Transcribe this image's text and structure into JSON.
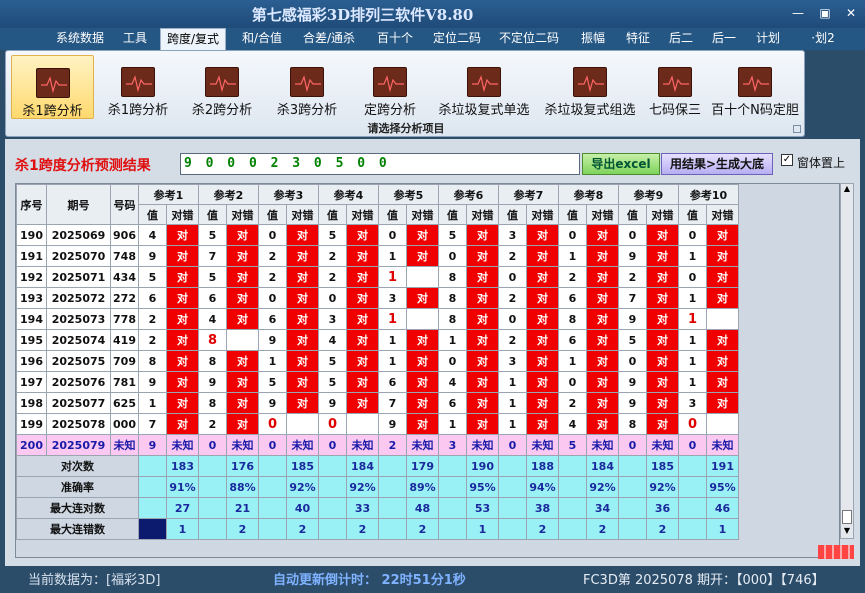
{
  "window": {
    "title": "第七感福彩3D排列三软件V8.80",
    "controls": [
      "—",
      "▣",
      "✕"
    ]
  },
  "menu": [
    "系统数据",
    "工具",
    "跨度/复式",
    "和/合值",
    "合差/通杀",
    "百十个",
    "定位二码",
    "不定位二码",
    "振幅",
    "特征",
    "后二",
    "后一",
    "计划",
    "·划2"
  ],
  "ribbon": {
    "buttons": [
      "杀1跨分析",
      "杀1跨分析",
      "杀2跨分析",
      "杀3跨分析",
      "定跨分析",
      "杀垃圾复式单选",
      "杀垃圾复式组选",
      "七码保三",
      "百十个N码定胆"
    ],
    "caption": "请选择分析项目"
  },
  "panel": {
    "title": "杀1跨度分析预测结果",
    "result": "9 0 0 0 2 3 0 5 0 0",
    "excel_button": "导出excel",
    "gen_button": "用结果>生成大底",
    "ontop_check": "✓",
    "ontop_label": "窗体置上"
  },
  "table": {
    "headers": {
      "seq": "序号",
      "period": "期号",
      "code": "号码",
      "refs": [
        "参考1",
        "参考2",
        "参考3",
        "参考4",
        "参考5",
        "参考6",
        "参考7",
        "参考8",
        "参考9",
        "参考10"
      ],
      "val": "值",
      "dc": "对错"
    },
    "rows": [
      {
        "seq": "190",
        "period": "2025069",
        "code": "906",
        "v": [
          "4",
          "5",
          "0",
          "5",
          "0",
          "5",
          "3",
          "0",
          "0",
          "0"
        ],
        "r": [
          "对",
          "对",
          "对",
          "对",
          "对",
          "对",
          "对",
          "对",
          "对",
          "对"
        ]
      },
      {
        "seq": "191",
        "period": "2025070",
        "code": "748",
        "v": [
          "9",
          "7",
          "2",
          "2",
          "1",
          "0",
          "2",
          "1",
          "9",
          "1"
        ],
        "r": [
          "对",
          "对",
          "对",
          "对",
          "对",
          "对",
          "对",
          "对",
          "对",
          "对"
        ]
      },
      {
        "seq": "192",
        "period": "2025071",
        "code": "434",
        "v": [
          "5",
          "5",
          "2",
          "2",
          "1",
          "8",
          "0",
          "2",
          "2",
          "0"
        ],
        "r": [
          "对",
          "对",
          "对",
          "对",
          "",
          "对",
          "对",
          "对",
          "对",
          "对"
        ]
      },
      {
        "seq": "193",
        "period": "2025072",
        "code": "272",
        "v": [
          "6",
          "6",
          "0",
          "0",
          "3",
          "8",
          "2",
          "6",
          "7",
          "1"
        ],
        "r": [
          "对",
          "对",
          "对",
          "对",
          "对",
          "对",
          "对",
          "对",
          "对",
          "对"
        ]
      },
      {
        "seq": "194",
        "period": "2025073",
        "code": "778",
        "v": [
          "2",
          "4",
          "6",
          "3",
          "1",
          "8",
          "0",
          "8",
          "9",
          "1"
        ],
        "r": [
          "对",
          "对",
          "对",
          "对",
          "",
          "对",
          "对",
          "对",
          "对",
          ""
        ]
      },
      {
        "seq": "195",
        "period": "2025074",
        "code": "419",
        "v": [
          "2",
          "8",
          "9",
          "4",
          "1",
          "1",
          "2",
          "6",
          "5",
          "1"
        ],
        "r": [
          "对",
          "",
          "对",
          "对",
          "对",
          "对",
          "对",
          "对",
          "对",
          "对"
        ]
      },
      {
        "seq": "196",
        "period": "2025075",
        "code": "709",
        "v": [
          "8",
          "8",
          "1",
          "5",
          "1",
          "0",
          "3",
          "1",
          "0",
          "1"
        ],
        "r": [
          "对",
          "对",
          "对",
          "对",
          "对",
          "对",
          "对",
          "对",
          "对",
          "对"
        ]
      },
      {
        "seq": "197",
        "period": "2025076",
        "code": "781",
        "v": [
          "9",
          "9",
          "5",
          "5",
          "6",
          "4",
          "1",
          "0",
          "9",
          "1"
        ],
        "r": [
          "对",
          "对",
          "对",
          "对",
          "对",
          "对",
          "对",
          "对",
          "对",
          "对"
        ]
      },
      {
        "seq": "198",
        "period": "2025077",
        "code": "625",
        "v": [
          "1",
          "8",
          "9",
          "9",
          "7",
          "6",
          "1",
          "2",
          "9",
          "3"
        ],
        "r": [
          "对",
          "对",
          "对",
          "对",
          "对",
          "对",
          "对",
          "对",
          "对",
          "对"
        ]
      },
      {
        "seq": "199",
        "period": "2025078",
        "code": "000",
        "v": [
          "7",
          "2",
          "0",
          "0",
          "9",
          "1",
          "1",
          "4",
          "8",
          "0"
        ],
        "r": [
          "对",
          "对",
          "",
          "",
          "对",
          "对",
          "对",
          "对",
          "对",
          ""
        ]
      },
      {
        "seq": "200",
        "period": "2025079",
        "code": "未知",
        "v": [
          "9",
          "0",
          "0",
          "0",
          "2",
          "3",
          "0",
          "5",
          "0",
          "0"
        ],
        "r": [
          "未知",
          "未知",
          "未知",
          "未知",
          "未知",
          "未知",
          "未知",
          "未知",
          "未知",
          "未知"
        ]
      }
    ],
    "stats": [
      {
        "label": "对次数",
        "values": [
          "183",
          "176",
          "185",
          "184",
          "179",
          "190",
          "188",
          "184",
          "185",
          "191"
        ]
      },
      {
        "label": "准确率",
        "values": [
          "91%",
          "88%",
          "92%",
          "92%",
          "89%",
          "95%",
          "94%",
          "92%",
          "92%",
          "95%"
        ]
      },
      {
        "label": "最大连对数",
        "values": [
          "27",
          "21",
          "40",
          "33",
          "48",
          "53",
          "38",
          "34",
          "36",
          "46"
        ]
      },
      {
        "label": "最大连错数",
        "values": [
          "1",
          "2",
          "2",
          "2",
          "2",
          "1",
          "2",
          "2",
          "2",
          "1"
        ]
      }
    ]
  },
  "status": {
    "current": "当前数据为：[福彩3D]",
    "countdown": "自动更新倒计时：  22时51分1秒",
    "issue": "FC3D第 2025078 期开：【000】【746】"
  },
  "colors": {
    "red": "#f00000",
    "cyan": "#99f0f5",
    "pink": "#fbc8f2",
    "navy": "#0d1b6e"
  }
}
